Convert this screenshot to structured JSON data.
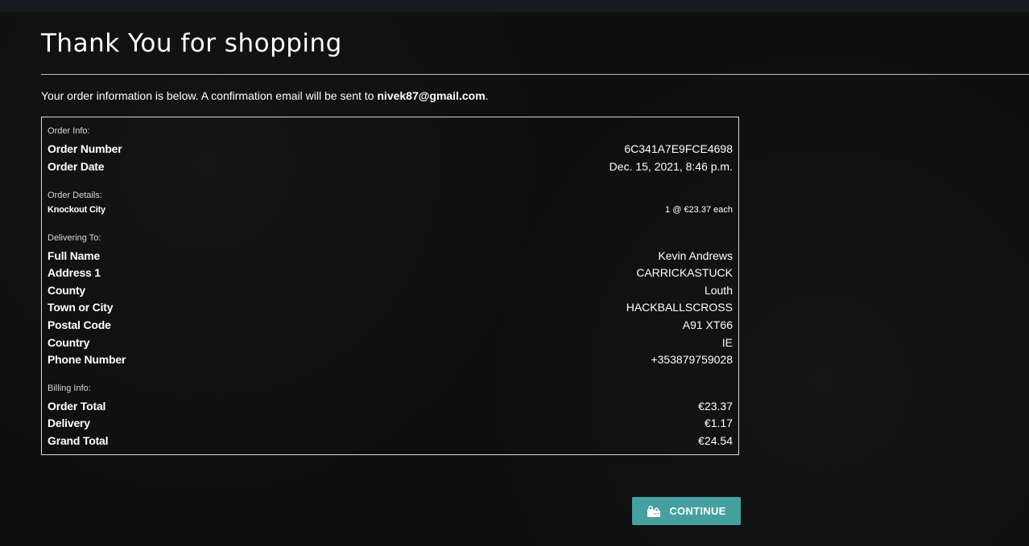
{
  "page": {
    "title": "Thank You for shopping",
    "intro_prefix": "Your order information is below. A confirmation email will be sent to ",
    "intro_email": "nivek87@gmail.com",
    "intro_suffix": "."
  },
  "order_info": {
    "section_label": "Order Info:",
    "order_number_label": "Order Number",
    "order_number": "6C341A7E9FCE4698",
    "order_date_label": "Order Date",
    "order_date": "Dec. 15, 2021, 8:46 p.m."
  },
  "order_details": {
    "section_label": "Order Details:",
    "items": [
      {
        "name": "Knockout City",
        "quantity_price": "1 @ €23.37 each"
      }
    ]
  },
  "delivery": {
    "section_label": "Delivering To:",
    "full_name_label": "Full Name",
    "full_name": "Kevin Andrews",
    "address1_label": "Address 1",
    "address1": "CARRICKASTUCK",
    "county_label": "County",
    "county": "Louth",
    "town_label": "Town or City",
    "town": "HACKBALLSCROSS",
    "postal_code_label": "Postal Code",
    "postal_code": "A91 XT66",
    "country_label": "Country",
    "country": "IE",
    "phone_label": "Phone Number",
    "phone": "+353879759028"
  },
  "billing": {
    "section_label": "Billing Info:",
    "order_total_label": "Order Total",
    "order_total": "€23.37",
    "delivery_label": "Delivery",
    "delivery": "€1.17",
    "grand_total_label": "Grand Total",
    "grand_total": "€24.54"
  },
  "actions": {
    "continue_label": "CONTINUE",
    "continue_icon": "shopping-bags-icon",
    "button_color": "#45a09f"
  }
}
